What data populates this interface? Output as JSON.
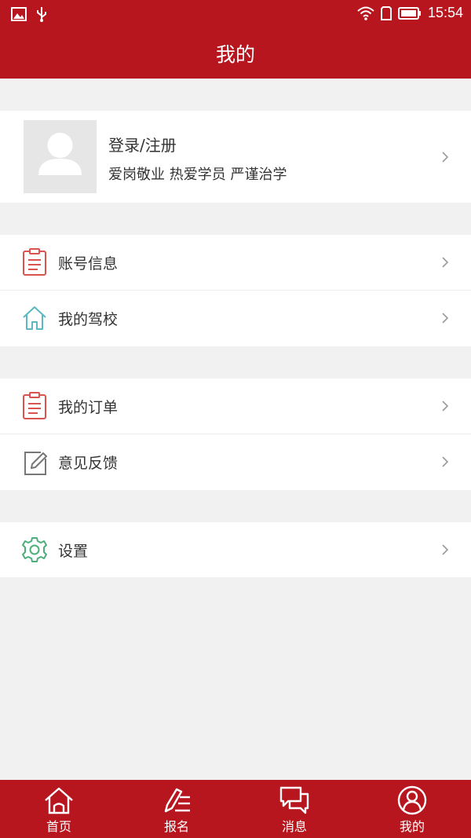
{
  "status_bar": {
    "time": "15:54"
  },
  "header": {
    "title": "我的"
  },
  "profile": {
    "name": "登录/注册",
    "motto": "爱岗敬业 热爱学员 严谨治学"
  },
  "menu_groups": [
    {
      "items": [
        {
          "label": "账号信息",
          "icon": "clipboard-icon"
        },
        {
          "label": "我的驾校",
          "icon": "home-icon"
        }
      ]
    },
    {
      "items": [
        {
          "label": "我的订单",
          "icon": "clipboard-icon"
        },
        {
          "label": "意见反馈",
          "icon": "edit-icon"
        }
      ]
    },
    {
      "items": [
        {
          "label": "设置",
          "icon": "gear-icon"
        }
      ]
    }
  ],
  "bottom_nav": [
    {
      "label": "首页",
      "icon": "home-icon"
    },
    {
      "label": "报名",
      "icon": "pen-icon"
    },
    {
      "label": "消息",
      "icon": "chat-icon"
    },
    {
      "label": "我的",
      "icon": "profile-icon",
      "active": true
    }
  ],
  "colors": {
    "primary": "#b8161f",
    "background": "#f1f1f1",
    "icon_red": "#d9534f",
    "icon_teal": "#5bb7c0",
    "icon_gray": "#777777",
    "icon_green": "#4caf7a"
  }
}
